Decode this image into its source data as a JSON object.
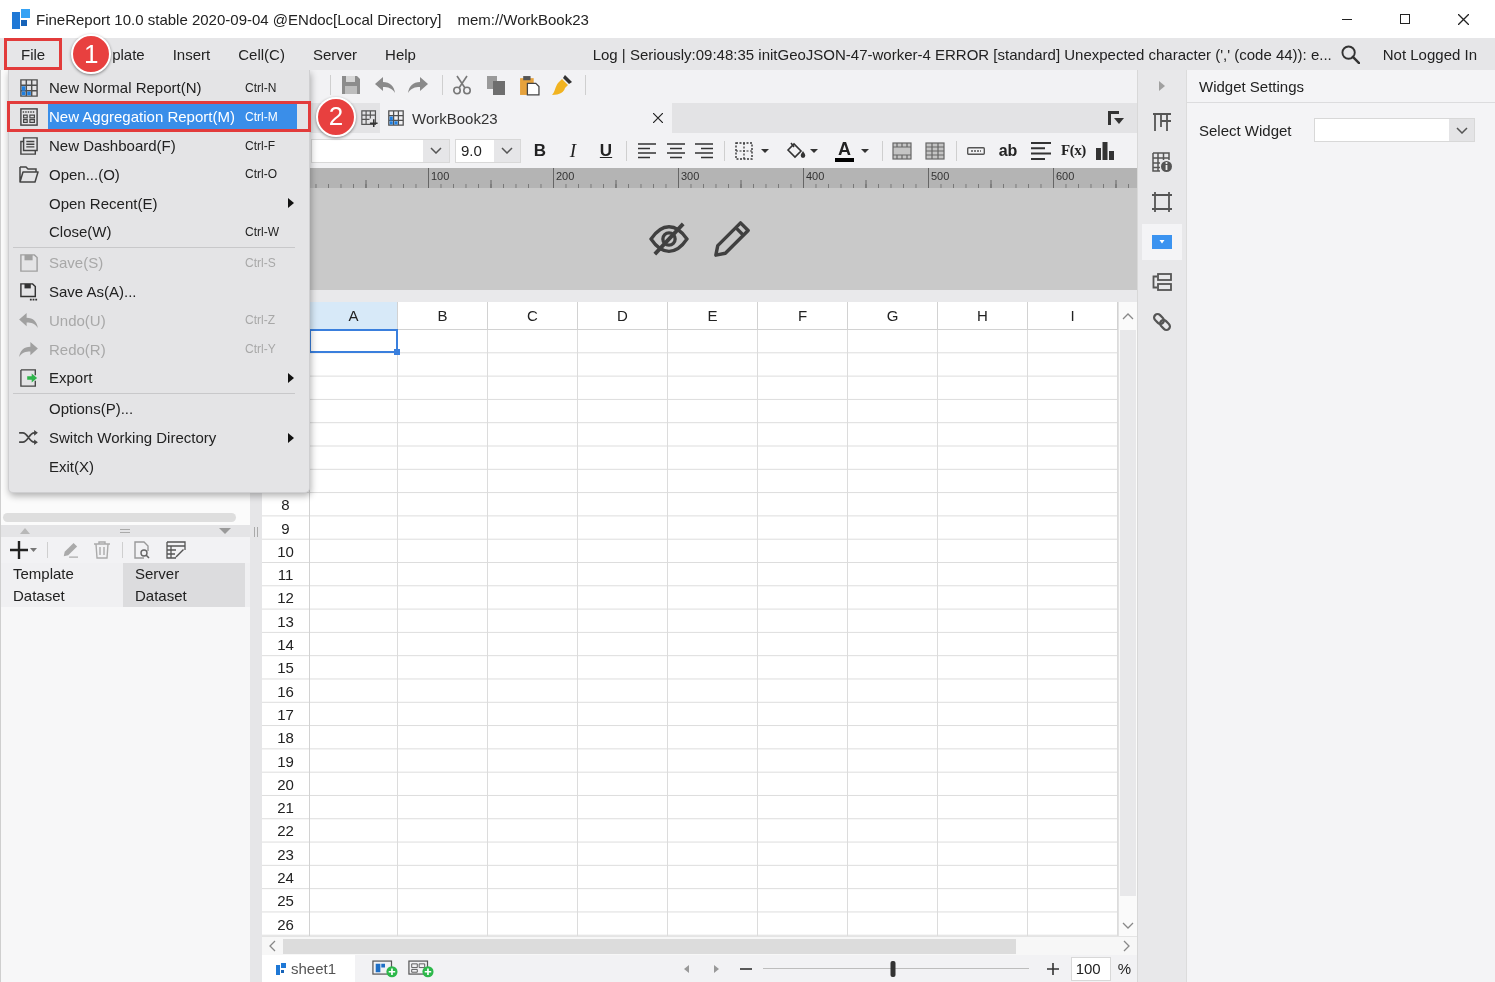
{
  "window": {
    "title": "FineReport 10.0 stable 2020-09-04 @ENdoc[Local Directory]",
    "document": "mem://WorkBook23"
  },
  "menu_bar": {
    "items": [
      {
        "label": "File",
        "callout": "1"
      },
      {
        "label": "plate"
      },
      {
        "label": "Insert"
      },
      {
        "label": "Cell(C)"
      },
      {
        "label": "Server"
      },
      {
        "label": "Help"
      }
    ],
    "log": "Log | Seriously:09:48:35 initGeoJSON-47-worker-4 ERROR [standard] Unexpected character (',' (code 44)): e...",
    "account": "Not Logged In"
  },
  "file_menu": {
    "groups": [
      [
        {
          "label": "New Normal Report(N)",
          "shortcut": "Ctrl-N",
          "selected": false,
          "disabled": false,
          "submenu": false
        },
        {
          "label": "New Aggregation Report(M)",
          "shortcut": "Ctrl-M",
          "selected": true,
          "disabled": false,
          "submenu": false,
          "callout": "2"
        },
        {
          "label": "New Dashboard(F)",
          "shortcut": "Ctrl-F",
          "selected": false,
          "disabled": false,
          "submenu": false
        },
        {
          "label": "Open...(O)",
          "shortcut": "Ctrl-O",
          "selected": false,
          "disabled": false,
          "submenu": false
        },
        {
          "label": "Open Recent(E)",
          "selected": false,
          "disabled": false,
          "submenu": true
        },
        {
          "label": "Close(W)",
          "shortcut": "Ctrl-W",
          "selected": false,
          "disabled": false,
          "submenu": false
        }
      ],
      [
        {
          "label": "Save(S)",
          "shortcut": "Ctrl-S",
          "selected": false,
          "disabled": true,
          "submenu": false
        },
        {
          "label": "Save As(A)...",
          "selected": false,
          "disabled": false,
          "submenu": false
        },
        {
          "label": "Undo(U)",
          "shortcut": "Ctrl-Z",
          "selected": false,
          "disabled": true,
          "submenu": false
        },
        {
          "label": "Redo(R)",
          "shortcut": "Ctrl-Y",
          "selected": false,
          "disabled": true,
          "submenu": false
        },
        {
          "label": "Export",
          "selected": false,
          "disabled": false,
          "submenu": true
        }
      ],
      [
        {
          "label": "Options(P)...",
          "selected": false,
          "disabled": false,
          "submenu": false
        },
        {
          "label": "Switch Working Directory",
          "selected": false,
          "disabled": false,
          "submenu": true
        },
        {
          "label": "Exit(X)",
          "selected": false,
          "disabled": false,
          "submenu": false
        }
      ]
    ]
  },
  "dataset_panel": {
    "tabs": [
      {
        "label": "Template Dataset",
        "selected": true
      },
      {
        "label": "Server Dataset",
        "selected": false
      }
    ]
  },
  "editor_tabs": [
    {
      "label": "WorkBook23",
      "selected": true
    }
  ],
  "format_toolbar": {
    "font_points": "9.0",
    "style_buttons": [
      "B",
      "I",
      "U"
    ],
    "font_color_button": "A",
    "text_widget_button": "ab",
    "formula_button": "F(x)"
  },
  "ruler": {
    "labels": [
      "100",
      "200",
      "300",
      "400",
      "500",
      "600"
    ]
  },
  "sheet": {
    "columns": [
      {
        "label": "A",
        "selected": true
      },
      {
        "label": "B",
        "selected": false
      },
      {
        "label": "C",
        "selected": false
      },
      {
        "label": "D",
        "selected": false
      },
      {
        "label": "E",
        "selected": false
      },
      {
        "label": "F",
        "selected": false
      },
      {
        "label": "G",
        "selected": false
      },
      {
        "label": "H",
        "selected": false
      },
      {
        "label": "I",
        "selected": false
      }
    ],
    "row_numbers": [
      "8",
      "9",
      "10",
      "11",
      "12",
      "13",
      "14",
      "15",
      "16",
      "17",
      "18",
      "19",
      "20",
      "21",
      "22",
      "23",
      "24",
      "25",
      "26"
    ]
  },
  "status_bar": {
    "sheet_tabs": [
      {
        "label": "sheet1",
        "selected": true
      }
    ],
    "zoom": {
      "level": 0.49,
      "value": "100",
      "unit": "%"
    }
  },
  "side_tools": [
    {
      "kind": "cell-attributes",
      "selected": false
    },
    {
      "kind": "cell-element",
      "selected": false
    },
    {
      "kind": "shape",
      "selected": false
    },
    {
      "kind": "widget",
      "selected": true
    },
    {
      "kind": "condition",
      "selected": false
    },
    {
      "kind": "hyperlink",
      "selected": false
    }
  ],
  "widget_panel": {
    "title": "Widget Settings",
    "select_label": "Select Widget"
  }
}
